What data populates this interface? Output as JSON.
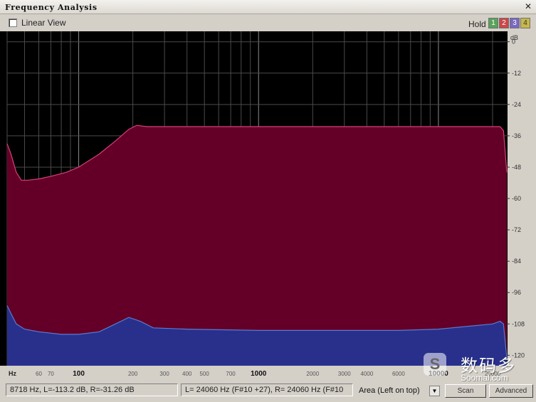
{
  "window": {
    "title": "Frequency Analysis",
    "close_glyph": "✕"
  },
  "toolbar": {
    "linear_view_label": "Linear View",
    "linear_view_checked": false,
    "hold_label": "Hold",
    "hold_buttons": [
      "1",
      "2",
      "3",
      "4"
    ],
    "hold_colors": [
      "#59a35a",
      "#c84848",
      "#7a68c0",
      "#c8b848"
    ]
  },
  "chart_data": {
    "type": "area",
    "xscale": "log",
    "xlabel": "Hz",
    "ylabel": "dB",
    "xlim": [
      40,
      24000
    ],
    "ylim": [
      -124,
      4
    ],
    "grid": true,
    "x_ticks": [
      "60",
      "70",
      "100",
      "200",
      "300",
      "400",
      "500",
      "700",
      "1000",
      "2000",
      "3000",
      "4000",
      "6000",
      "10000",
      "20000"
    ],
    "x_tick_values": [
      60,
      70,
      100,
      200,
      300,
      400,
      500,
      700,
      1000,
      2000,
      3000,
      4000,
      6000,
      10000,
      20000
    ],
    "x_tick_major": [
      100,
      1000,
      10000
    ],
    "y_ticks": [
      0,
      -12,
      -24,
      -36,
      -48,
      -60,
      -72,
      -84,
      -96,
      -108,
      -120
    ],
    "series": [
      {
        "channel": "left",
        "color": "#640027",
        "edge": "#d8407a",
        "x": [
          40,
          42,
          45,
          48,
          52,
          60,
          70,
          85,
          100,
          130,
          160,
          190,
          210,
          240,
          300,
          500,
          1000,
          3000,
          10000,
          20000,
          22000,
          23000,
          24000
        ],
        "y": [
          -39,
          -43,
          -50,
          -53,
          -53,
          -52.5,
          -51.5,
          -50,
          -48,
          -43,
          -38,
          -33.5,
          -32,
          -32.5,
          -32.5,
          -32.5,
          -32.5,
          -32.5,
          -32.5,
          -32.5,
          -32.5,
          -34,
          -50
        ]
      },
      {
        "channel": "right",
        "color": "#28308c",
        "edge": "#5a7ad0",
        "x": [
          40,
          42,
          45,
          50,
          60,
          80,
          100,
          130,
          160,
          190,
          220,
          260,
          400,
          1000,
          3000,
          6000,
          10000,
          20000,
          22000,
          23000,
          24000
        ],
        "y": [
          -101,
          -104,
          -108,
          -110,
          -111,
          -112,
          -112,
          -111,
          -108,
          -105.5,
          -107,
          -109.5,
          -110,
          -110.5,
          -110.5,
          -110.5,
          -110,
          -108,
          -107,
          -108,
          -121
        ]
      }
    ]
  },
  "status": {
    "cursor_readout": "8718 Hz, L=-113.2 dB, R=-31.26 dB",
    "peak_readout": "L=  24060 Hz (F#10 +27), R=  24060 Hz (F#10",
    "view_mode": "Area (Left on top)",
    "scan_label": "Scan",
    "advanced_label": "Advanced"
  },
  "watermark": {
    "cn_text": "数码多",
    "url_text": "Soomal.com",
    "logo_glyph": "S"
  }
}
